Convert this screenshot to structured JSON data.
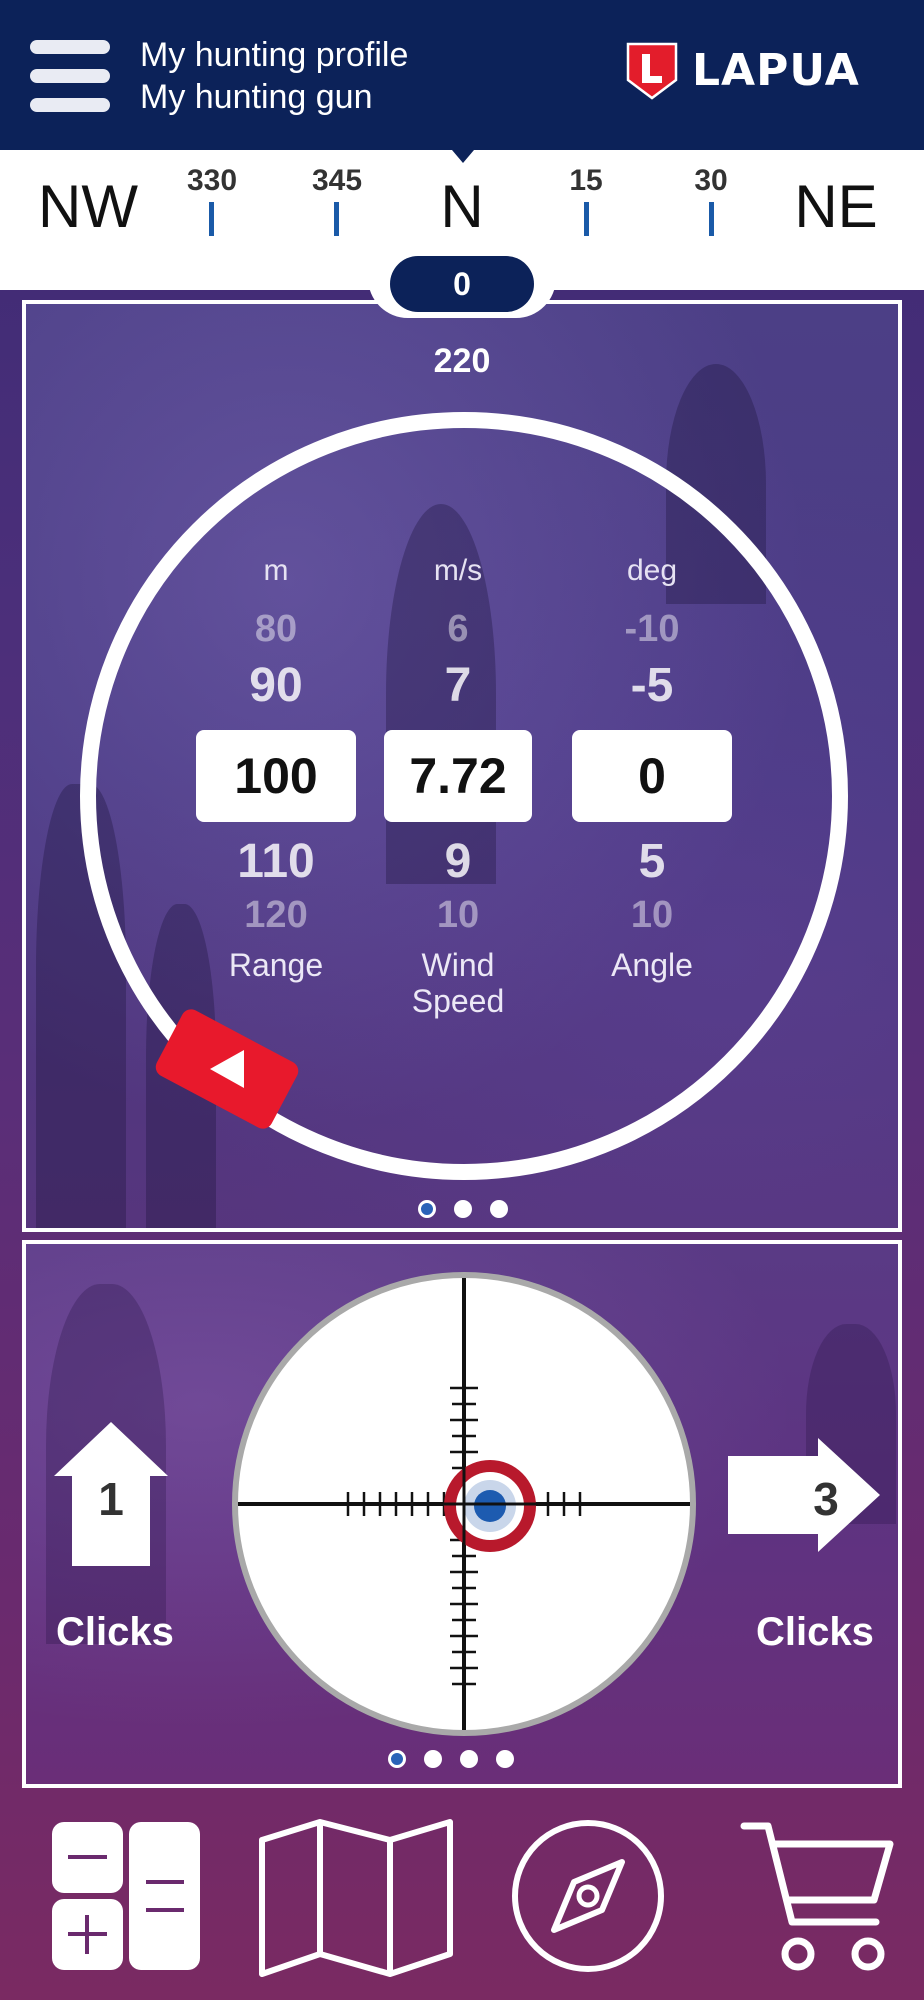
{
  "header": {
    "menu_icon": "hamburger-menu-icon",
    "link_profile": "My hunting profile",
    "link_gun": "My hunting gun",
    "brand_name": "LAPUA",
    "brand_color": "#e31d2b",
    "bar_color": "#0c2259"
  },
  "compass": {
    "labels": {
      "nw": "NW",
      "d330": "330",
      "d345": "345",
      "n": "N",
      "d15": "15",
      "d30": "30",
      "ne": "NE"
    },
    "heading": "0",
    "tick_color": "#1a5aa8"
  },
  "dial": {
    "direction_value": "220",
    "range": {
      "unit": "m",
      "above2": "80",
      "above1": "90",
      "value": "100",
      "below1": "110",
      "below2": "120",
      "label": "Range"
    },
    "wind": {
      "unit": "m/s",
      "above2": "6",
      "above1": "7",
      "value": "7.72",
      "below1": "9",
      "below2": "10",
      "label_line1": "Wind",
      "label_line2": "Speed"
    },
    "angle": {
      "unit": "deg",
      "above2": "-10",
      "above1": "-5",
      "value": "0",
      "below1": "5",
      "below2": "10",
      "label": "Angle"
    },
    "fire_button_icon": "play-left-icon",
    "fire_color": "#e8192c",
    "page_total": 3,
    "page_active": 1
  },
  "scope": {
    "elevation_clicks": "1",
    "elevation_label": "Clicks",
    "elevation_icon": "arrow-up-icon",
    "windage_clicks": "3",
    "windage_label": "Clicks",
    "windage_icon": "arrow-right-icon",
    "page_total": 4,
    "page_active": 1
  },
  "toolbar": {
    "calculator_icon": "calculator-icon",
    "map_icon": "map-icon",
    "compass_icon": "compass-icon",
    "cart_icon": "shopping-cart-icon"
  }
}
